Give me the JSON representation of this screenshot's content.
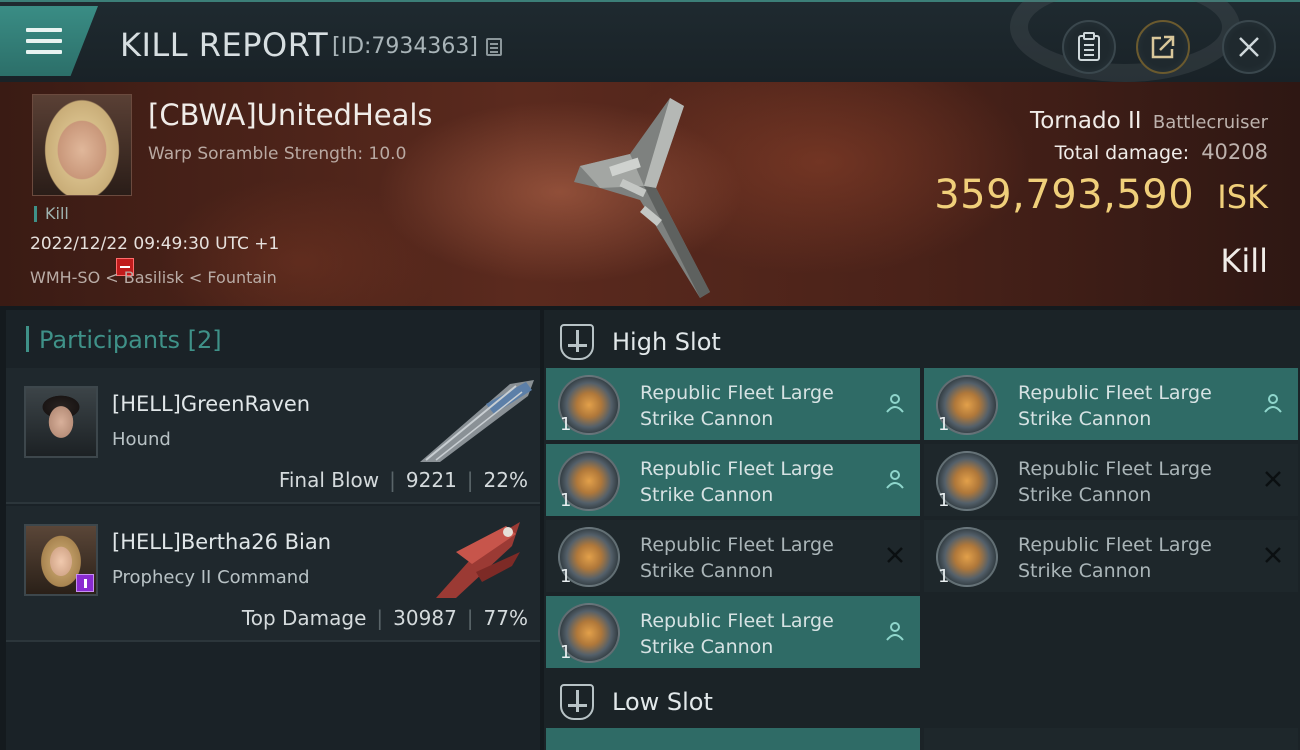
{
  "header": {
    "title": "KILL REPORT",
    "report_id": "[ID:7934363]",
    "icons": [
      "menu-icon",
      "copy-icon",
      "clipboard-icon",
      "share-icon",
      "close-icon"
    ]
  },
  "victim": {
    "name": "[CBWA]UnitedHeals",
    "subtitle": "Warp Soramble Strength: 10.0",
    "tag": "Kill",
    "time": "2022/12/22 09:49:30 UTC +1",
    "location": "WMH-SO < Basilisk < Fountain",
    "ship_name": "Tornado II",
    "ship_class": "Battlecruiser",
    "total_damage_label": "Total damage:",
    "total_damage": "40208",
    "isk_value": "359,793,590",
    "isk_unit": "ISK",
    "result": "Kill"
  },
  "participants": {
    "label": "Participants [2]",
    "items": [
      {
        "name": "[HELL]GreenRaven",
        "ship": "Hound",
        "role": "Final Blow",
        "damage": "9221",
        "percent": "22%"
      },
      {
        "name": "[HELL]Bertha26 Bian",
        "ship": "Prophecy II Command",
        "role": "Top Damage",
        "damage": "30987",
        "percent": "77%"
      }
    ]
  },
  "slots": {
    "high": {
      "title": "High Slot",
      "modules": [
        {
          "name": "Republic Fleet Large Strike Cannon",
          "qty": "1",
          "status": "dropped"
        },
        {
          "name": "Republic Fleet Large Strike Cannon",
          "qty": "1",
          "status": "dropped"
        },
        {
          "name": "Republic Fleet Large Strike Cannon",
          "qty": "1",
          "status": "dropped"
        },
        {
          "name": "Republic Fleet Large Strike Cannon",
          "qty": "1",
          "status": "destroyed"
        },
        {
          "name": "Republic Fleet Large Strike Cannon",
          "qty": "1",
          "status": "destroyed"
        },
        {
          "name": "Republic Fleet Large Strike Cannon",
          "qty": "1",
          "status": "destroyed"
        },
        {
          "name": "Republic Fleet Large Strike Cannon",
          "qty": "1",
          "status": "dropped"
        }
      ]
    },
    "low": {
      "title": "Low Slot"
    }
  },
  "colors": {
    "accent": "#3f9188",
    "isk": "#f0cf7a",
    "active_module": "#2f6b66"
  }
}
